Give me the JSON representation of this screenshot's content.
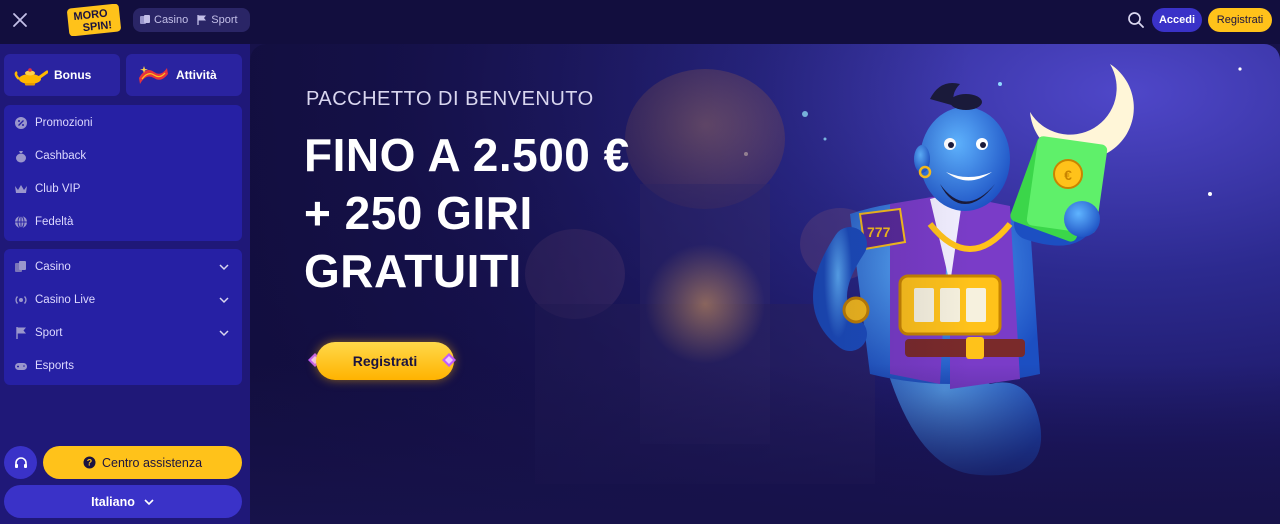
{
  "header": {
    "logo_text": [
      "MORO",
      "SPIN!"
    ],
    "mode_tabs": [
      {
        "label": "Casino",
        "icon": "cards-icon"
      },
      {
        "label": "Sport",
        "icon": "flag-icon"
      }
    ],
    "login_label": "Accedi",
    "signup_label": "Registrati"
  },
  "sidebar": {
    "quick_tabs": [
      {
        "label": "Bonus",
        "icon": "genie-lamp-icon"
      },
      {
        "label": "Attività",
        "icon": "flying-carpet-icon"
      }
    ],
    "promo_items": [
      {
        "label": "Promozioni",
        "icon": "promo-icon"
      },
      {
        "label": "Cashback",
        "icon": "money-bag-icon"
      },
      {
        "label": "Club VIP",
        "icon": "crown-icon"
      },
      {
        "label": "Fedeltà",
        "icon": "loyalty-icon"
      }
    ],
    "game_items": [
      {
        "label": "Casino",
        "icon": "cards-icon",
        "expandable": true
      },
      {
        "label": "Casino Live",
        "icon": "live-icon",
        "expandable": true
      },
      {
        "label": "Sport",
        "icon": "flag-icon",
        "expandable": true
      },
      {
        "label": "Esports",
        "icon": "gamepad-icon",
        "expandable": false
      }
    ],
    "support_label": "Centro assistenza",
    "language_label": "Italiano"
  },
  "banner": {
    "subtitle": "PACCHETTO DI BENVENUTO",
    "headline_lines": [
      "FINO A 2.500 €",
      "+ 250 GIRI",
      "GRATUITI"
    ],
    "cta_label": "Registrati"
  },
  "colors": {
    "accent_yellow": "#ffc21a",
    "accent_blue": "#3a32c8",
    "sidebar_bg": "#1f1878",
    "topbar_bg": "#120e3e"
  }
}
